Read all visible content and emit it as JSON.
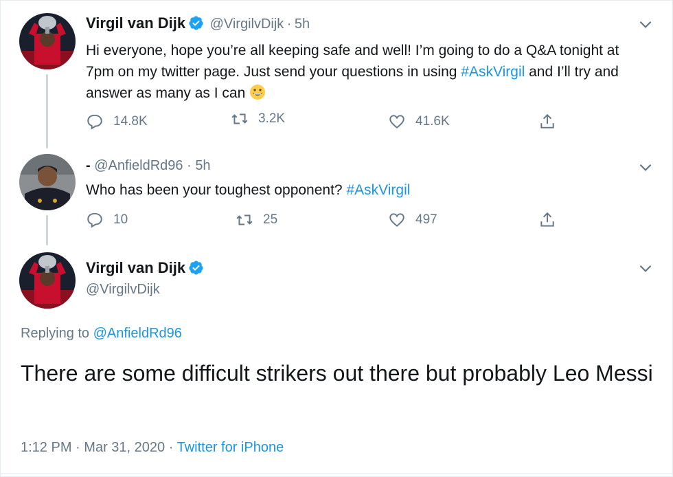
{
  "tweet1": {
    "name": "Virgil van Dijk",
    "handle": "@VirgilvDijk",
    "sep": "·",
    "time": "5h",
    "text_before": "Hi everyone, hope you’re all keeping safe and well! I’m going to do a Q&A tonight at 7pm on my twitter page. Just send your questions in using ",
    "hashtag": "#AskVirgil",
    "text_after": " and I’ll try and answer as many as I can ",
    "replies": "14.8K",
    "retweets": "3.2K",
    "likes": "41.6K"
  },
  "tweet2": {
    "name": "-",
    "handle": "@AnfieldRd96",
    "sep": "·",
    "time": "5h",
    "text": "Who has been your toughest opponent? ",
    "hashtag": "#AskVirgil",
    "replies": "10",
    "retweets": "25",
    "likes": "497"
  },
  "tweet3": {
    "name": "Virgil van Dijk",
    "handle": "@VirgilvDijk",
    "replying_prefix": "Replying to ",
    "replying_handle": "@AnfieldRd96",
    "text": "There are some difficult strikers out there but probably Leo Messi",
    "time": "1:12 PM",
    "sep1": "·",
    "date": "Mar 31, 2020",
    "sep2": "·",
    "source": "Twitter for iPhone"
  },
  "colors": {
    "accent": "#1b95e0",
    "muted": "#657786",
    "line": "#ccd6dd",
    "avatar_red": "#c8102e"
  },
  "icons": [
    "caret-down-icon",
    "verified-badge-icon",
    "reply-icon",
    "retweet-icon",
    "like-icon",
    "share-icon",
    "grinning-emoji-icon"
  ]
}
